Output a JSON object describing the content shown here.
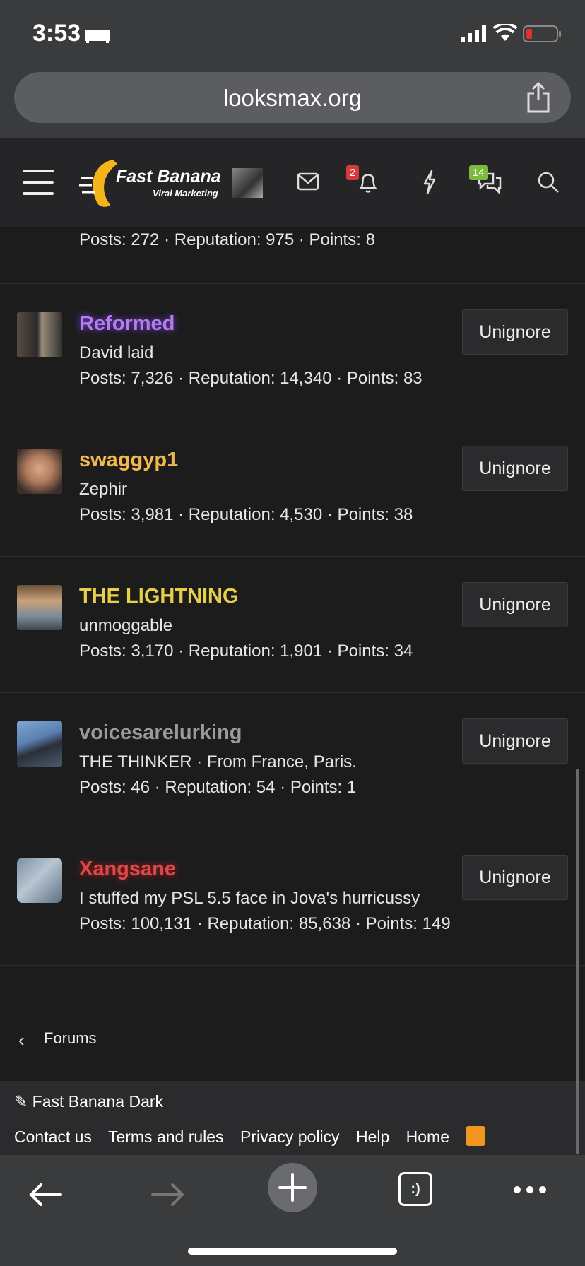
{
  "status_bar": {
    "time": "3:53"
  },
  "browser": {
    "url": "looksmax.org"
  },
  "site": {
    "logo_title": "Fast Banana",
    "logo_subtitle": "Viral Marketing",
    "alerts_count": "2",
    "conversations_count": "14"
  },
  "previous_row_stats": "Posts: 272 · Reputation: 975 · Points: 8",
  "unignore_label": "Unignore",
  "ignored_users": [
    {
      "name": "Reformed",
      "title": "David laid",
      "stats": "Posts: 7,326 · Reputation: 14,340 · Points: 83",
      "color": "#b57cf0"
    },
    {
      "name": "swaggyp1",
      "title": "Zephir",
      "stats": "Posts: 3,981 · Reputation: 4,530 · Points: 38",
      "color": "#f2b84b"
    },
    {
      "name": "THE LIGHTNING",
      "title": "unmoggable",
      "stats": "Posts: 3,170 · Reputation: 1,901 · Points: 34",
      "color": "#e8cf4a"
    },
    {
      "name": "voicesarelurking",
      "title": "THE THINKER · From France, Paris.",
      "stats": "Posts: 46 · Reputation: 54 · Points: 1",
      "color": "#9a9a9a"
    },
    {
      "name": "Xangsane",
      "title": "I stuffed my PSL 5.5 face in Jova's hurricussy",
      "stats": "Posts: 100,131 · Reputation: 85,638 · Points: 149",
      "color": "#e04848"
    }
  ],
  "breadcrumb": {
    "label": "Forums"
  },
  "footer": {
    "style_name": "Fast Banana Dark",
    "links": [
      "Contact us",
      "Terms and rules",
      "Privacy policy",
      "Help",
      "Home"
    ]
  },
  "toolbar": {
    "tabs_label": ":)"
  }
}
